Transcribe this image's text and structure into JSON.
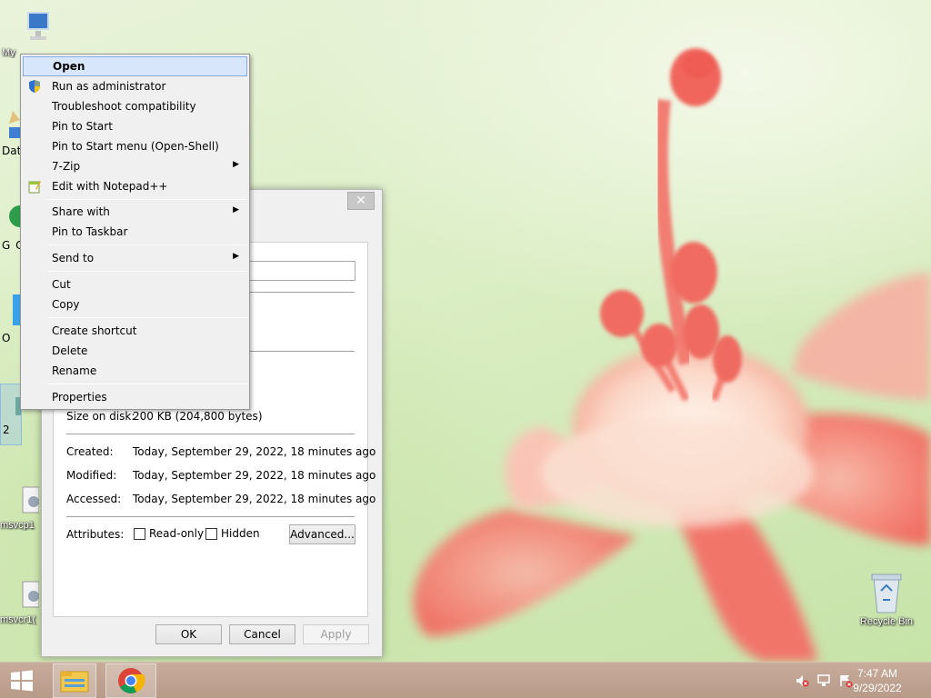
{
  "desktop": {
    "icons": [
      {
        "label": "My",
        "kind": "computer"
      },
      {
        "label": "Dat",
        "kind": "data"
      },
      {
        "label": "msvcp1",
        "kind": "dll"
      },
      {
        "label": "msvcr1(",
        "kind": "dll"
      },
      {
        "label": "Recycle Bin",
        "kind": "recycle-bin"
      }
    ],
    "peek_letters": [
      "G",
      "C",
      "O",
      "2"
    ]
  },
  "context_menu": {
    "items": [
      {
        "label": "Open",
        "highlighted": true
      },
      {
        "label": "Run as administrator",
        "icon": "uac-shield-icon"
      },
      {
        "label": "Troubleshoot compatibility"
      },
      {
        "label": "Pin to Start"
      },
      {
        "label": "Pin to Start menu (Open-Shell)"
      },
      {
        "label": "7-Zip",
        "submenu": true
      },
      {
        "label": "Edit with Notepad++",
        "icon": "notepad-plus-plus-icon"
      },
      {
        "label": "Share with",
        "submenu": true
      },
      {
        "label": "Pin to Taskbar"
      },
      {
        "label": "Send to",
        "submenu": true
      },
      {
        "label": "Cut"
      },
      {
        "label": "Copy"
      },
      {
        "label": "Create shortcut"
      },
      {
        "label": "Delete"
      },
      {
        "label": "Rename"
      },
      {
        "label": "Properties"
      }
    ]
  },
  "properties_dialog": {
    "close_glyph": "✕",
    "size_on_disk": {
      "label": "Size on disk:",
      "value": "200 KB (204,800 bytes)"
    },
    "created": {
      "label": "Created:",
      "value": "Today, September 29, 2022, 18 minutes ago"
    },
    "modified": {
      "label": "Modified:",
      "value": "Today, September 29, 2022, 18 minutes ago"
    },
    "accessed": {
      "label": "Accessed:",
      "value": "Today, September 29, 2022, 18 minutes ago"
    },
    "attributes": {
      "label": "Attributes:",
      "read_only": {
        "label": "Read-only",
        "checked": false
      },
      "hidden": {
        "label": "Hidden",
        "checked": false
      },
      "advanced_label": "Advanced..."
    },
    "buttons": {
      "ok": "OK",
      "cancel": "Cancel",
      "apply": "Apply"
    }
  },
  "taskbar": {
    "clock": {
      "time": "7:47 AM",
      "date": "9/29/2022"
    },
    "pinned": [
      "file-explorer-icon",
      "chrome-icon"
    ],
    "tray": [
      "volume-muted-icon",
      "network-icon",
      "action-center-icon"
    ]
  },
  "colors": {
    "menu_highlight": "#d7e6fa",
    "menu_highlight_border": "#84acdd",
    "taskbar": "#c2a594",
    "flower": "#f2776e"
  }
}
